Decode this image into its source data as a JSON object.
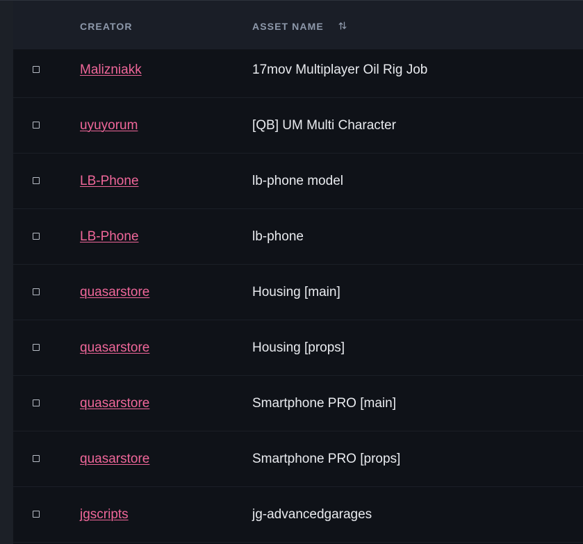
{
  "table": {
    "headers": {
      "creator": "CREATOR",
      "asset_name": "ASSET NAME"
    },
    "sort_icon": "sort-arrows-icon",
    "rows": [
      {
        "creator": "Malizniakk",
        "asset": "17mov Multiplayer Oil Rig Job"
      },
      {
        "creator": "uyuyorum",
        "asset": "[QB] UM Multi Character"
      },
      {
        "creator": "LB-Phone",
        "asset": "lb-phone model"
      },
      {
        "creator": "LB-Phone",
        "asset": "lb-phone"
      },
      {
        "creator": "quasarstore",
        "asset": "Housing [main]"
      },
      {
        "creator": "quasarstore",
        "asset": "Housing [props]"
      },
      {
        "creator": "quasarstore",
        "asset": "Smartphone PRO [main]"
      },
      {
        "creator": "quasarstore",
        "asset": "Smartphone PRO [props]"
      },
      {
        "creator": "jgscripts",
        "asset": "jg-advancedgarages"
      }
    ]
  },
  "colors": {
    "creator_link": "#f0679a",
    "header_text": "#8e99ab",
    "row_text": "#e9ebef",
    "table_bg": "#0f1218",
    "header_bg": "#1a1e27"
  }
}
